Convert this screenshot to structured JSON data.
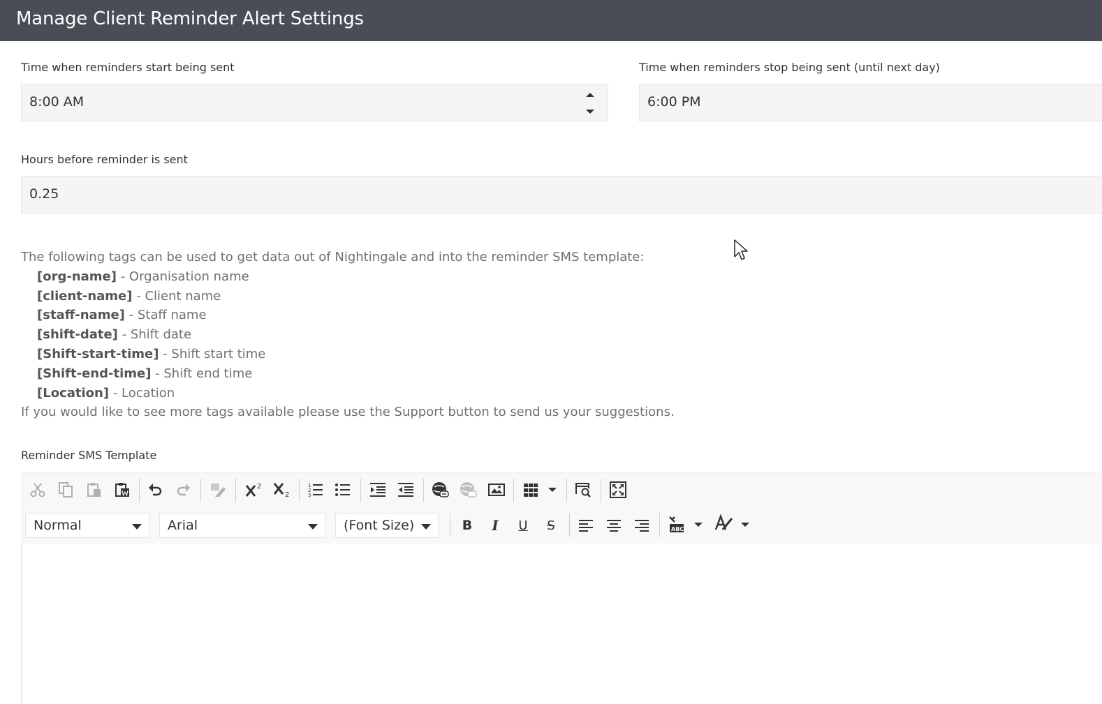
{
  "header": {
    "title": "Manage Client Reminder Alert Settings"
  },
  "start_time": {
    "label": "Time when reminders start being sent",
    "value": "8:00 AM"
  },
  "stop_time": {
    "label": "Time when reminders stop being sent (until next day)",
    "value": "6:00 PM"
  },
  "hours_before": {
    "label": "Hours before reminder is sent",
    "value": "0.25"
  },
  "tags_info": {
    "intro": "The following tags can be used to get data out of Nightingale and into the reminder SMS template:",
    "tags": [
      {
        "tag": "[org-name]",
        "desc": " - Organisation name"
      },
      {
        "tag": "[client-name]",
        "desc": " - Client name"
      },
      {
        "tag": "[staff-name]",
        "desc": " - Staff name"
      },
      {
        "tag": "[shift-date]",
        "desc": " - Shift date"
      },
      {
        "tag": "[Shift-start-time]",
        "desc": " - Shift start time"
      },
      {
        "tag": "[Shift-end-time]",
        "desc": " - Shift end time"
      },
      {
        "tag": "[Location]",
        "desc": " - Location"
      }
    ],
    "outro": "If you would like to see more tags available please use the Support button to send us your suggestions."
  },
  "sms_template": {
    "label": "Reminder SMS Template",
    "format_select": "Normal",
    "font_select": "Arial",
    "size_select": "(Font Size)",
    "bold_glyph": "B",
    "italic_glyph": "I",
    "underline_glyph": "U",
    "strike_glyph": "S",
    "content": ""
  },
  "colors": {
    "header_bg": "#494e56",
    "field_bg": "#f5f5f5",
    "toolbar_bg": "#f8f8f8"
  }
}
